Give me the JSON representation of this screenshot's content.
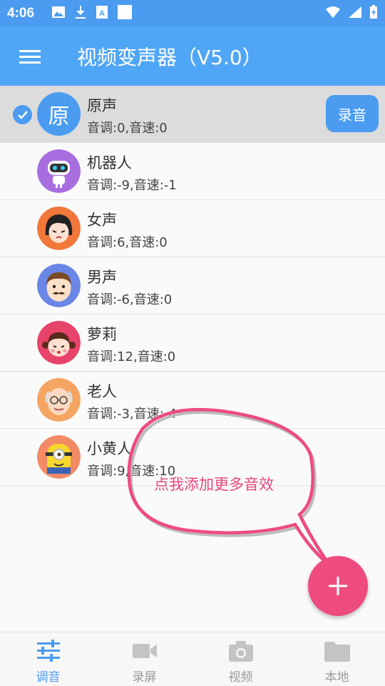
{
  "status_bar": {
    "time": "4:06",
    "icons": [
      "image-icon",
      "download-icon",
      "font-icon",
      "blank-square-icon",
      "wifi-icon",
      "signal-icon",
      "battery-icon"
    ]
  },
  "app_bar": {
    "title": "视频变声器（V5.0）",
    "menu_icon": "hamburger-menu-icon"
  },
  "colors": {
    "primary": "#50a6f6",
    "status_bar": "#4b9cf0",
    "fab": "#ee4b7e",
    "callout": "#e8487a",
    "selected_row": "#dcdcdc"
  },
  "voices": [
    {
      "name": "原声",
      "params": "音调:0,音速:0",
      "avatar_char": "原",
      "selected": true
    },
    {
      "name": "机器人",
      "params": "音调:-9,音速:-1"
    },
    {
      "name": "女声",
      "params": "音调:6,音速:0"
    },
    {
      "name": "男声",
      "params": "音调:-6,音速:0"
    },
    {
      "name": "萝莉",
      "params": "音调:12,音速:0"
    },
    {
      "name": "老人",
      "params": "音调:-3,音速:-4"
    },
    {
      "name": "小黄人",
      "params": "音调:9,音速:10"
    }
  ],
  "record_button": "录音",
  "callout": {
    "text": "点我添加更多音效"
  },
  "fab_icon": "plus-icon",
  "bottom_nav": [
    {
      "label": "调音",
      "icon": "sliders-icon",
      "active": true
    },
    {
      "label": "录屏",
      "icon": "video-camera-icon"
    },
    {
      "label": "视频",
      "icon": "camera-icon"
    },
    {
      "label": "本地",
      "icon": "folder-icon"
    }
  ]
}
